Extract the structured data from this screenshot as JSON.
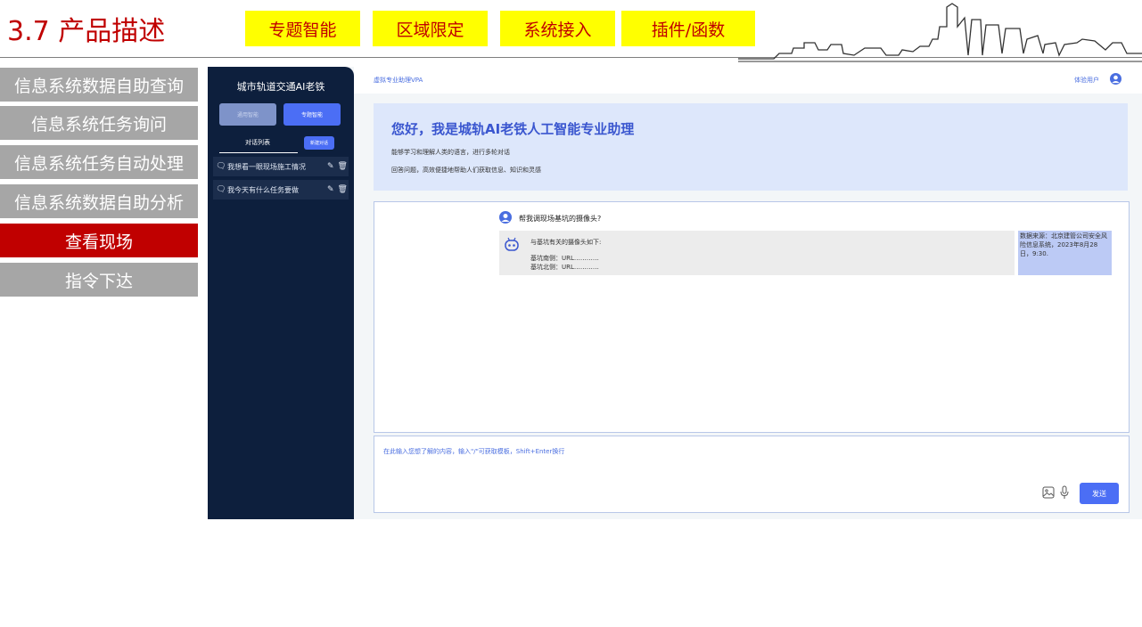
{
  "slide": {
    "title": "3.7 产品描述",
    "tags": [
      "专题智能",
      "区域限定",
      "系统接入",
      "插件/函数"
    ],
    "accent_color": "#c00000",
    "tag_color": "#ffff00"
  },
  "left_nav": {
    "items": [
      {
        "label": "信息系统数据自助查询",
        "active": false
      },
      {
        "label": "信息系统任务询问",
        "active": false
      },
      {
        "label": "信息系统任务自动处理",
        "active": false
      },
      {
        "label": "信息系统数据自助分析",
        "active": false
      },
      {
        "label": "查看现场",
        "active": true
      },
      {
        "label": "指令下达",
        "active": false
      }
    ]
  },
  "app": {
    "sidebar": {
      "title": "城市轨道交通AI老铁",
      "mode_buttons": [
        "通用智能",
        "专题智能"
      ],
      "tab_label": "对话列表",
      "new_chat_label": "新建对话",
      "conversations": [
        {
          "title": "我想看一眼现场施工情况"
        },
        {
          "title": "我今天有什么任务要做"
        }
      ]
    },
    "topbar": {
      "breadcrumb": "虚拟专业助理VPA",
      "user_label": "体验用户"
    },
    "hero": {
      "heading": "您好，我是城轨AI老铁人工智能专业助理",
      "line1": "能够学习和理解人类的语言，进行多轮对话",
      "line2": "回答问题，高效便捷地帮助人们获取信息、知识和灵感"
    },
    "chat": {
      "question": "帮我调现场基坑的摄像头?",
      "answer_intro": "与基坑有关的摄像头如下:",
      "answer_lines": [
        "基坑南侧：URL…………",
        "基坑北侧：URL…………"
      ],
      "source_note": "数据来源：北京建管公司安全风险信息系统，2023年8月28日，9:30."
    },
    "input": {
      "placeholder": "在此输入您想了解的内容，输入\"/\"可获取模板，Shift+Enter换行",
      "send_label": "发送"
    }
  }
}
